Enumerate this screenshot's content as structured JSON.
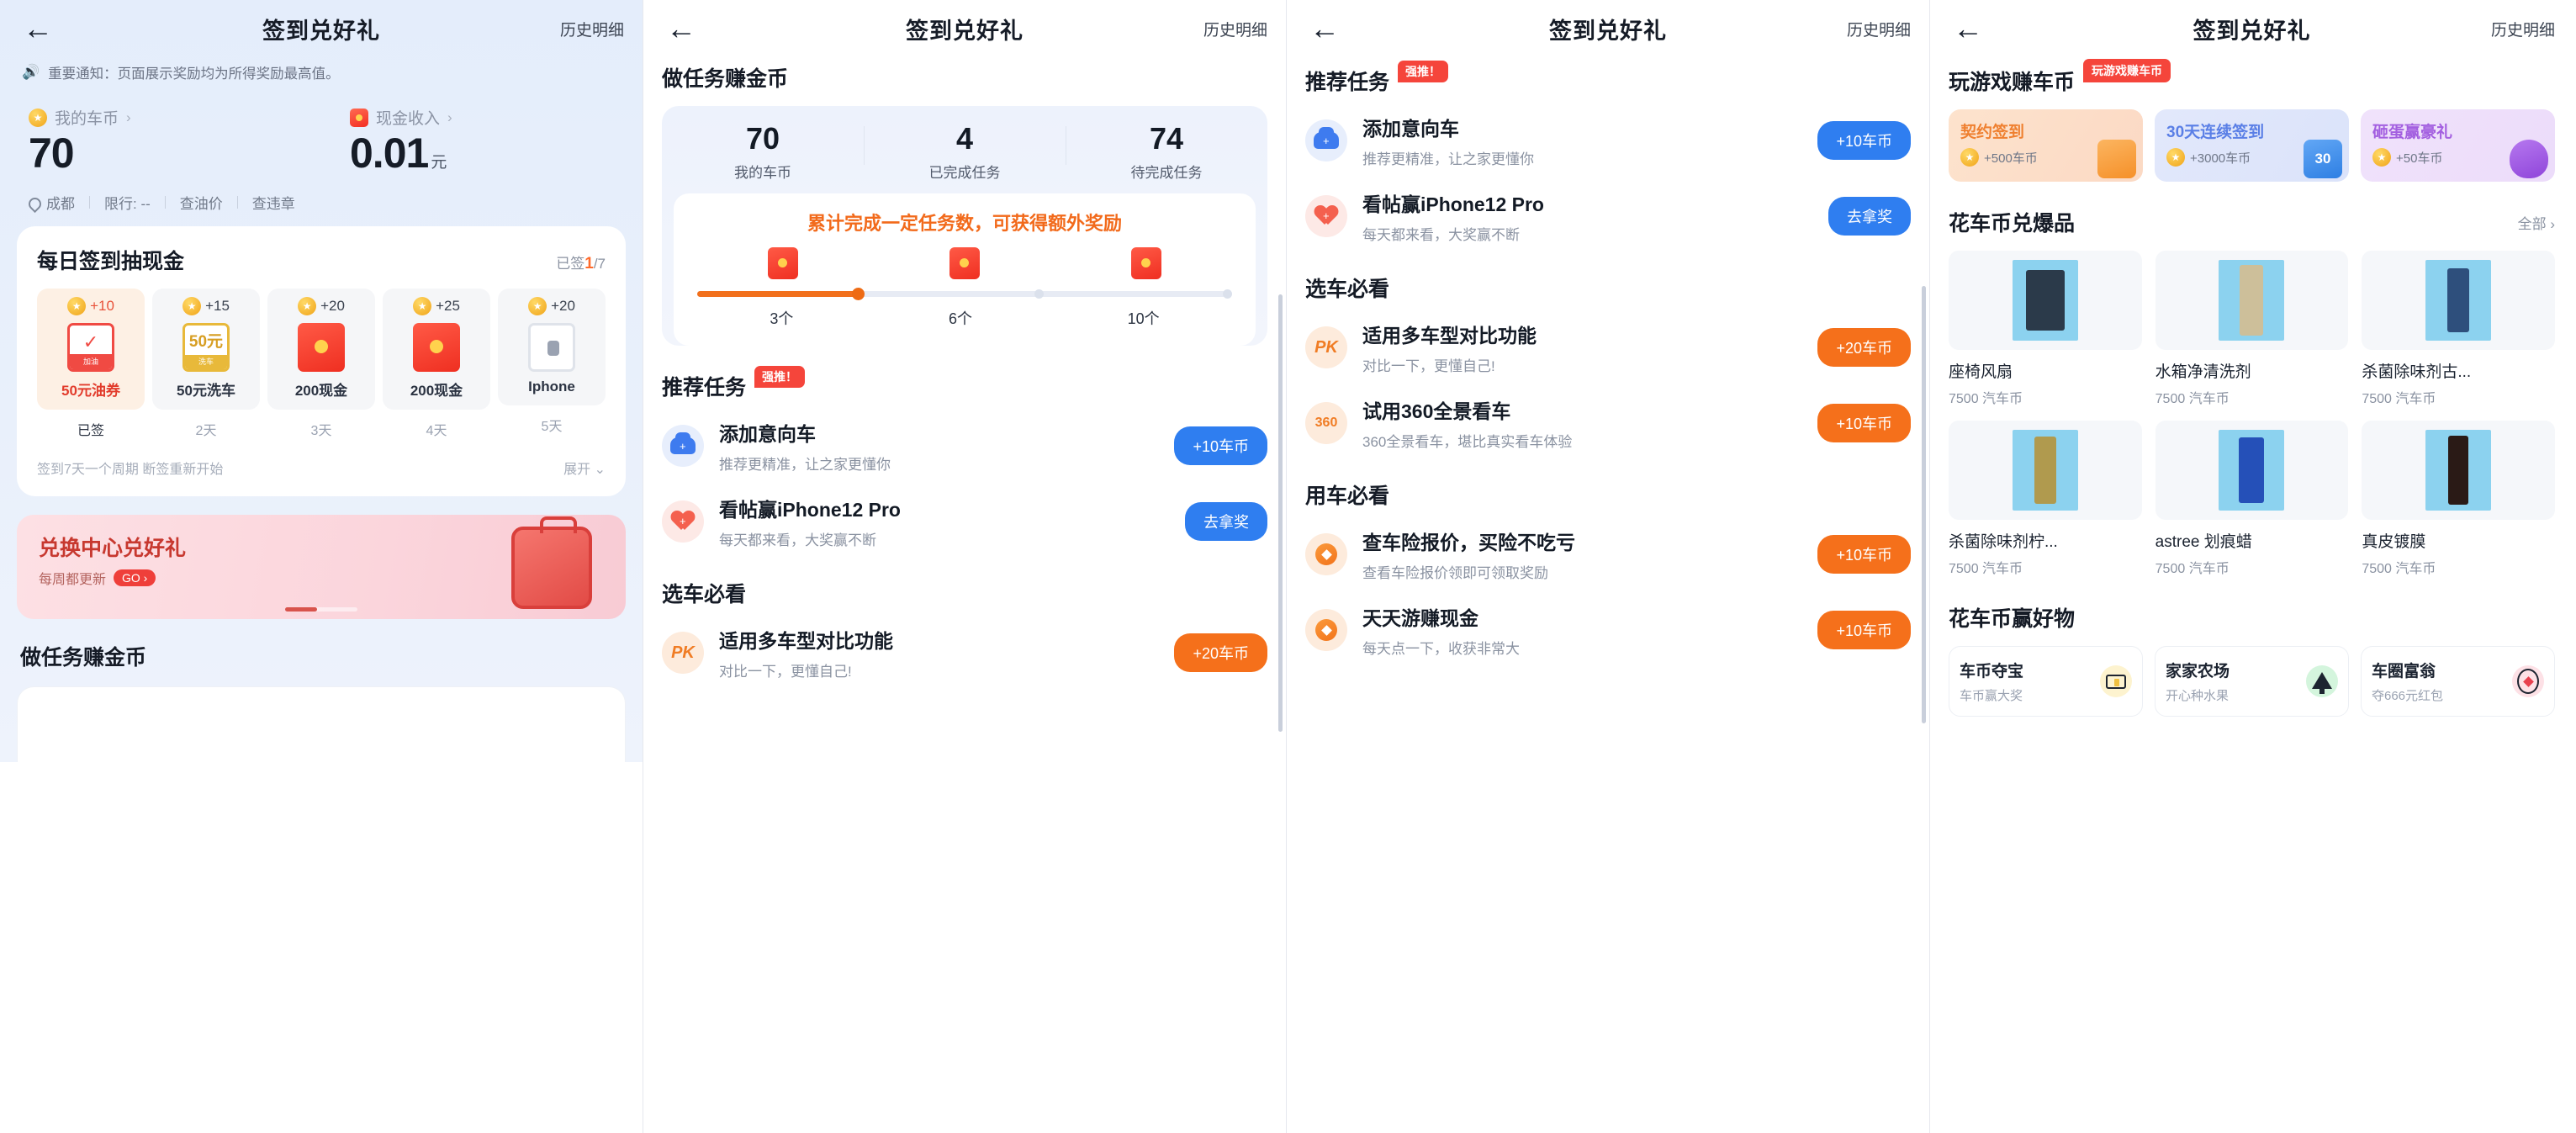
{
  "nav": {
    "back_icon": "arrow-left-icon",
    "title": "签到兑好礼",
    "right_label": "历史明细"
  },
  "panel1": {
    "notice": {
      "icon": "megaphone-icon",
      "text": "重要通知：页面展示奖励均为所得奖励最高值。"
    },
    "balance_coin": {
      "icon": "coin-icon",
      "label": "我的车币",
      "arrow": "›",
      "value": "70"
    },
    "balance_cash": {
      "icon": "red-packet-icon",
      "label": "现金收入",
      "arrow": "›",
      "value": "0.01",
      "unit": "元"
    },
    "meta": {
      "city": "成都",
      "limit": "限行: --",
      "fuel": "查油价",
      "violation": "查违章"
    },
    "signin": {
      "title": "每日签到抽现金",
      "signed_label": "已签",
      "signed_count": "1",
      "signed_total": "/7",
      "days": [
        {
          "reward": "+10",
          "gift": "50元油券",
          "day": "已签",
          "state": "done",
          "badge": "加油"
        },
        {
          "reward": "+15",
          "gift": "50元洗车",
          "day": "2天",
          "state": "todo",
          "badge": "洗车",
          "amount": "50元"
        },
        {
          "reward": "+20",
          "gift": "200现金",
          "day": "3天",
          "state": "todo"
        },
        {
          "reward": "+25",
          "gift": "200现金",
          "day": "4天",
          "state": "todo"
        },
        {
          "reward": "+20",
          "gift": "Iphone",
          "day": "5天",
          "state": "todo"
        }
      ],
      "footer_note": "签到7天一个周期 断签重新开始",
      "expand": "展开"
    },
    "banner": {
      "title": "兑换中心兑好礼",
      "subtitle": "每周都更新",
      "cta": "GO ›"
    },
    "next_section": "做任务赚金币"
  },
  "panel2": {
    "section_title": "做任务赚金币",
    "stats": [
      {
        "value": "70",
        "label": "我的车币"
      },
      {
        "value": "4",
        "label": "已完成任务"
      },
      {
        "value": "74",
        "label": "待完成任务"
      }
    ],
    "progress": {
      "headline": "累计完成一定任务数，可获得额外奖励",
      "ticks": [
        "3个",
        "6个",
        "10个"
      ],
      "percent": 30
    },
    "recommend": {
      "title": "推荐任务",
      "tag": "强推！"
    },
    "tasks_recommend": [
      {
        "icon": "car-plus-icon",
        "title": "添加意向车",
        "desc": "推荐更精准，让之家更懂你",
        "button": "+10车币",
        "button_style": "blue"
      },
      {
        "icon": "heart-plus-icon",
        "title": "看帖赢iPhone12 Pro",
        "desc": "每天都来看，大奖赢不断",
        "button": "去拿奖",
        "button_style": "blue"
      }
    ],
    "choose_title": "选车必看",
    "tasks_choose": [
      {
        "icon": "pk-icon",
        "title": "适用多车型对比功能",
        "desc": "对比一下，更懂自己!",
        "button": "+20车币",
        "button_style": "orange"
      }
    ]
  },
  "panel3": {
    "recommend": {
      "title": "推荐任务",
      "tag": "强推！"
    },
    "tasks_recommend": [
      {
        "icon": "car-plus-icon",
        "title": "添加意向车",
        "desc": "推荐更精准，让之家更懂你",
        "button": "+10车币",
        "button_style": "blue"
      },
      {
        "icon": "heart-plus-icon",
        "title": "看帖赢iPhone12 Pro",
        "desc": "每天都来看，大奖赢不断",
        "button": "去拿奖",
        "button_style": "blue"
      }
    ],
    "choose_title": "选车必看",
    "tasks_choose": [
      {
        "icon": "pk-icon",
        "title": "适用多车型对比功能",
        "desc": "对比一下，更懂自己!",
        "button": "+20车币",
        "button_style": "orange"
      },
      {
        "icon": "360-icon",
        "title": "试用360全景看车",
        "desc": "360全景看车，堪比真实看车体验",
        "button": "+10车币",
        "button_style": "orange"
      }
    ],
    "use_title": "用车必看",
    "tasks_use": [
      {
        "icon": "diamond-icon",
        "title": "查车险报价，买险不吃亏",
        "desc": "查看车险报价领即可领取奖励",
        "button": "+10车币",
        "button_style": "orange"
      },
      {
        "icon": "diamond-icon",
        "title": "天天游赚现金",
        "desc": "每天点一下，收获非常大",
        "button": "+10车币",
        "button_style": "orange"
      }
    ]
  },
  "panel4": {
    "game_section": {
      "title": "玩游戏赚车币",
      "tag": "玩游戏赚车币"
    },
    "game_banners": [
      {
        "title": "契约签到",
        "reward": "+500车币",
        "art": "clipboard-check-icon"
      },
      {
        "title": "30天连续签到",
        "reward": "+3000车币",
        "art": "calendar-30-icon"
      },
      {
        "title": "砸蛋赢豪礼",
        "reward": "+50车币",
        "art": "egg-hammer-icon"
      }
    ],
    "shop_section": {
      "title": "花车币兑爆品",
      "all_label": "全部",
      "all_arrow": "›"
    },
    "products": [
      {
        "name": "座椅风扇",
        "price": "7500 汽车币",
        "img_color": "#2b3a4a"
      },
      {
        "name": "水箱净清洗剂",
        "price": "7500 汽车币",
        "img_color": "#cdbf9a"
      },
      {
        "name": "杀菌除味剂古...",
        "price": "7500 汽车币",
        "img_color": "#2e4f7c"
      },
      {
        "name": "杀菌除味剂柠...",
        "price": "7500 汽车币",
        "img_color": "#b09a4e"
      },
      {
        "name": "astree 划痕蜡",
        "price": "7500 汽车币",
        "img_color": "#2550b8"
      },
      {
        "name": "真皮镀膜",
        "price": "7500 汽车币",
        "img_color": "#2a1a16"
      }
    ],
    "win_section": {
      "title": "花车币赢好物"
    },
    "win_cards": [
      {
        "title": "车币夺宝",
        "desc": "车币赢大奖",
        "icon": "treasure-chest-icon"
      },
      {
        "title": "家家农场",
        "desc": "开心种水果",
        "icon": "tree-icon"
      },
      {
        "title": "车圈富翁",
        "desc": "夺666元红包",
        "icon": "gem-icon"
      }
    ]
  }
}
